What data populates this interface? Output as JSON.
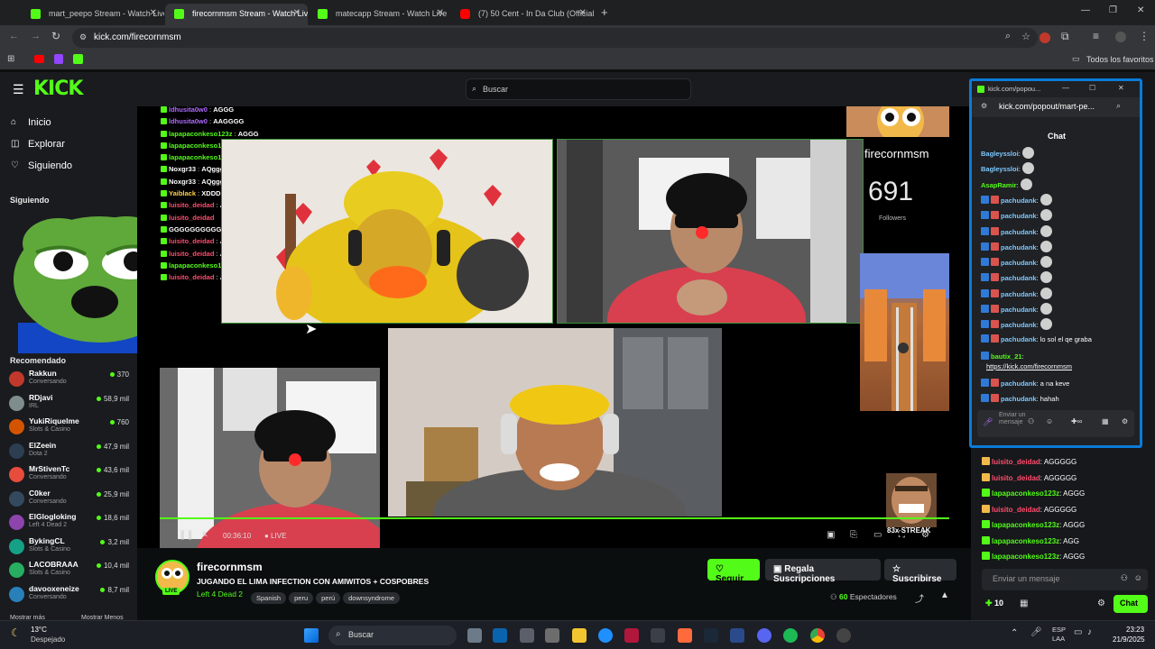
{
  "browser": {
    "tabs": [
      {
        "title": "mart_peepo Stream - Watch Live"
      },
      {
        "title": "firecornmsm Stream - Watch Live"
      },
      {
        "title": "matecapp Stream - Watch Live"
      },
      {
        "title": "(7) 50 Cent - In Da Club (Official"
      }
    ],
    "url": "kick.com/firecornmsm",
    "bookmarks_label": "Todos los favoritos"
  },
  "site": {
    "logo": "KICK",
    "search_placeholder": "Buscar"
  },
  "sidebar": {
    "nav": [
      {
        "label": "Inicio",
        "icon": "home-icon"
      },
      {
        "label": "Explorar",
        "icon": "compass-icon"
      },
      {
        "label": "Siguiendo",
        "icon": "heart-icon"
      }
    ],
    "following_title": "Siguiendo",
    "recommended_title": "Recomendado",
    "recommended": [
      {
        "name": "Rakkun",
        "category": "Conversando",
        "viewers": "370",
        "color": "#c0392b"
      },
      {
        "name": "RDjavi",
        "category": "IRL",
        "viewers": "58,9 mil",
        "color": "#7f8c8d"
      },
      {
        "name": "YukiRiquelme",
        "category": "Slots & Casino",
        "viewers": "760",
        "color": "#d35400"
      },
      {
        "name": "ElZeein",
        "category": "Dota 2",
        "viewers": "47,9 mil",
        "color": "#2c3e50"
      },
      {
        "name": "MrStivenTc",
        "category": "Conversando",
        "viewers": "43,6 mil",
        "color": "#e74c3c"
      },
      {
        "name": "C0ker",
        "category": "Conversando",
        "viewers": "25,9 mil",
        "color": "#34495e"
      },
      {
        "name": "ElGlogloking",
        "category": "Left 4 Dead 2",
        "viewers": "18,6 mil",
        "color": "#8e44ad"
      },
      {
        "name": "BykingCL",
        "category": "Slots & Casino",
        "viewers": "3,2 mil",
        "color": "#16a085"
      },
      {
        "name": "LACOBRAAA",
        "category": "Slots & Casino",
        "viewers": "10,4 mil",
        "color": "#27ae60"
      },
      {
        "name": "davooxeneize",
        "category": "Conversando",
        "viewers": "8,7 mil",
        "color": "#2980b9"
      }
    ],
    "show_more": "Mostrar más",
    "show_less": "Mostrar Menos"
  },
  "video_overlay": {
    "chat": [
      {
        "user": "ldhusita0w0",
        "msg": "AGGG",
        "color": "#b06bff"
      },
      {
        "user": "ldhusita0w0",
        "msg": "AAGGGG",
        "color": "#b06bff"
      },
      {
        "user": "lapapaconkeso123z",
        "msg": "AGGG",
        "color": "#53fc18"
      },
      {
        "user": "lapapaconkeso123z",
        "msg": "A",
        "color": "#53fc18"
      },
      {
        "user": "lapapaconkeso123z",
        "msg": "G",
        "color": "#53fc18"
      },
      {
        "user": "Noxgr33",
        "msg": "AQgggg",
        "color": "#ffffff"
      },
      {
        "user": "Noxgr33",
        "msg": "AQgggg",
        "color": "#ffffff"
      },
      {
        "user": "Yaiblack",
        "msg": "XDDDD",
        "color": "#ffd24a"
      },
      {
        "user": "luisito_deidad",
        "msg": "AGGGGGGG",
        "color": "#ff4d6d"
      },
      {
        "user": "luisito_deidad",
        "msg": "",
        "color": "#ff4d6d"
      },
      {
        "user": "",
        "msg": "GGGGGGGGGGG",
        "color": "#ffffff"
      },
      {
        "user": "luisito_deidad",
        "msg": "AGGGGG",
        "color": "#ff4d6d"
      },
      {
        "user": "luisito_deidad",
        "msg": "AGGGGG",
        "color": "#ff4d6d"
      },
      {
        "user": "lapapaconkeso123z",
        "msg": "AGGG",
        "color": "#53fc18"
      },
      {
        "user": "luisito_deidad",
        "msg": "AGGGGG",
        "color": "#ff4d6d"
      }
    ],
    "channel_name": "firecornmsm",
    "followers_count": "691",
    "followers_label": "Followers",
    "streak": "83x STREAK",
    "time": "00:36:10",
    "live": "LIVE"
  },
  "stream": {
    "channel": "firecornmsm",
    "live_badge": "LIVE",
    "title": "JUGANDO EL LIMA INFECTION CON AMIWITOS + COSPOBRES",
    "category": "Left 4 Dead 2",
    "tags": [
      "Spanish",
      "peru",
      "perú",
      "downsyndrome"
    ],
    "follow": "Seguir",
    "gift": "Regala Suscripciones",
    "subscribe": "Suscribirse",
    "viewers": "60",
    "viewers_label": "Espectadores"
  },
  "popout": {
    "url": "kick.com/popout/mart-pe...",
    "title_short": "kick.com/popou...",
    "chat_title": "Chat",
    "messages": [
      {
        "user": "Bagleyssloi",
        "msg": "",
        "color": "#7ec8ff"
      },
      {
        "user": "Bagleyssloi",
        "msg": "",
        "color": "#7ec8ff"
      },
      {
        "user": "AsapRamir",
        "msg": "",
        "color": "#53fc18"
      },
      {
        "user": "pachudank",
        "msg": "",
        "color": "#7ec8ff"
      },
      {
        "user": "pachudank",
        "msg": "",
        "color": "#7ec8ff"
      },
      {
        "user": "pachudank",
        "msg": "",
        "color": "#7ec8ff"
      },
      {
        "user": "pachudank",
        "msg": "",
        "color": "#7ec8ff"
      },
      {
        "user": "pachudank",
        "msg": "",
        "color": "#7ec8ff"
      },
      {
        "user": "pachudank",
        "msg": "",
        "color": "#7ec8ff"
      },
      {
        "user": "pachudank",
        "msg": "",
        "color": "#7ec8ff"
      },
      {
        "user": "pachudank",
        "msg": "",
        "color": "#7ec8ff"
      },
      {
        "user": "pachudank",
        "msg": "",
        "color": "#7ec8ff"
      },
      {
        "user": "pachudank",
        "msg": "lo sol el qe graba",
        "color": "#7ec8ff"
      }
    ],
    "bautix_user": "bautix_21",
    "bautix_link": "https://kick.com/firecornmsm",
    "messages2": [
      {
        "user": "pachudank",
        "msg": "a na keve"
      },
      {
        "user": "pachudank",
        "msg": "hahah"
      }
    ],
    "input_placeholder": "Enviar un mensaje"
  },
  "main_chat": {
    "messages": [
      {
        "user": "luisito_deidad",
        "msg": "AGGGGG",
        "color": "#ff4d6d"
      },
      {
        "user": "luisito_deidad",
        "msg": "AGGGGG",
        "color": "#ff4d6d"
      },
      {
        "user": "lapapaconkeso123z",
        "msg": "AGGG",
        "color": "#53fc18"
      },
      {
        "user": "luisito_deidad",
        "msg": "AGGGGG",
        "color": "#ff4d6d"
      },
      {
        "user": "lapapaconkeso123z",
        "msg": "AGGG",
        "color": "#53fc18"
      },
      {
        "user": "lapapaconkeso123z",
        "msg": "AGG",
        "color": "#53fc18"
      },
      {
        "user": "lapapaconkeso123z",
        "msg": "AGGG",
        "color": "#53fc18"
      }
    ],
    "input_placeholder": "Enviar un mensaje",
    "points": "10",
    "chat_button": "Chat"
  },
  "taskbar": {
    "weather_temp": "13°C",
    "weather_desc": "Despejado",
    "search": "Buscar",
    "lang1": "ESP",
    "lang2": "LAA",
    "time": "23:23",
    "date": "21/9/2025"
  },
  "colors": {
    "kick_green": "#53fc18",
    "popout_border": "#0b7bd8"
  }
}
